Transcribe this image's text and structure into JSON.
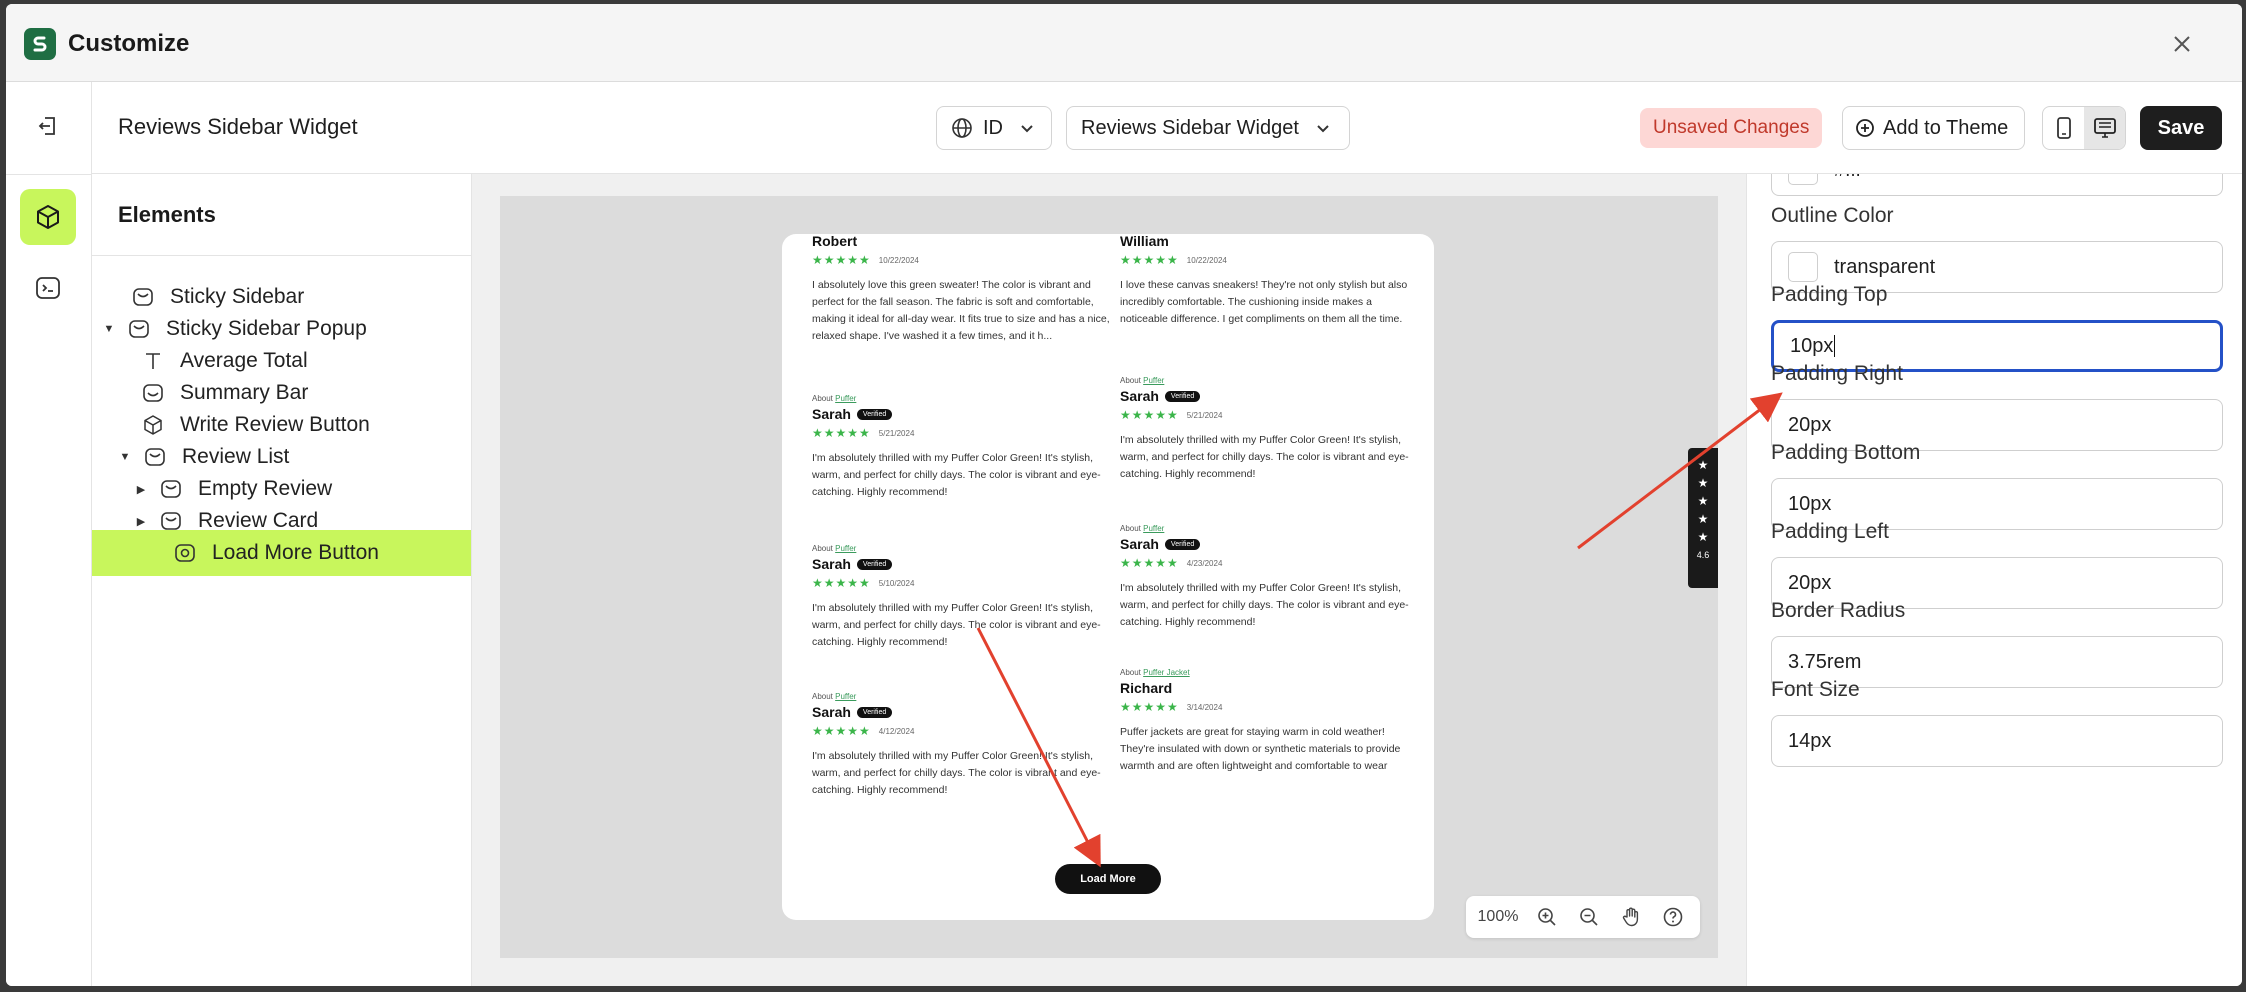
{
  "app": {
    "title": "Customize"
  },
  "toolbar": {
    "page_name": "Reviews Sidebar Widget",
    "language": "ID",
    "template": "Reviews Sidebar Widget",
    "unsaved": "Unsaved Changes",
    "add_to_theme": "Add to Theme",
    "save": "Save"
  },
  "elements_panel": {
    "title": "Elements",
    "items": [
      {
        "label": "Sticky Sidebar",
        "icon": "section-icon",
        "caret": ""
      },
      {
        "label": "Sticky Sidebar Popup",
        "icon": "section-icon",
        "caret": "expanded"
      },
      {
        "label": "Average Total",
        "icon": "text-icon",
        "caret": ""
      },
      {
        "label": "Summary Bar",
        "icon": "section-icon",
        "caret": ""
      },
      {
        "label": "Write Review Button",
        "icon": "box-icon",
        "caret": ""
      },
      {
        "label": "Review List",
        "icon": "section-icon",
        "caret": "expanded"
      },
      {
        "label": "Empty Review",
        "icon": "section-icon",
        "caret": "collapsed"
      },
      {
        "label": "Review Card",
        "icon": "section-icon",
        "caret": "collapsed"
      },
      {
        "label": "Load More Button",
        "icon": "button-icon",
        "caret": "",
        "selected": true
      }
    ]
  },
  "preview": {
    "reviews": [
      {
        "about": "",
        "product": "",
        "name": "Robert",
        "verified": false,
        "stars": "★★★★★",
        "date": "10/22/2024",
        "body": "I absolutely love this green sweater! The color is vibrant and perfect for the fall season. The fabric is soft and comfortable, making it ideal for all-day wear. It fits true to size and has a nice, relaxed shape. I've washed it a few times, and it h..."
      },
      {
        "about": "",
        "product": "",
        "name": "William",
        "verified": false,
        "stars": "★★★★★",
        "date": "10/22/2024",
        "body": "I love these canvas sneakers! They're not only stylish but also incredibly comfortable. The cushioning inside makes a noticeable difference. I get compliments on them all the time."
      },
      {
        "about": "About",
        "product": "Puffer",
        "name": "Sarah",
        "verified": true,
        "stars": "★★★★★",
        "date": "5/21/2024",
        "body": "I'm absolutely thrilled with my Puffer Color Green! It's stylish, warm, and perfect for chilly days. The color is vibrant and eye-catching. Highly recommend!"
      },
      {
        "about": "About",
        "product": "Puffer",
        "name": "Sarah",
        "verified": true,
        "stars": "★★★★★",
        "date": "5/21/2024",
        "body": "I'm absolutely thrilled with my Puffer Color Green! It's stylish, warm, and perfect for chilly days. The color is vibrant and eye-catching. Highly recommend!"
      },
      {
        "about": "About",
        "product": "Puffer",
        "name": "Sarah",
        "verified": true,
        "stars": "★★★★★",
        "date": "5/10/2024",
        "body": "I'm absolutely thrilled with my Puffer Color Green! It's stylish, warm, and perfect for chilly days. The color is vibrant and eye-catching. Highly recommend!"
      },
      {
        "about": "About",
        "product": "Puffer",
        "name": "Sarah",
        "verified": true,
        "stars": "★★★★★",
        "date": "4/23/2024",
        "body": "I'm absolutely thrilled with my Puffer Color Green! It's stylish, warm, and perfect for chilly days. The color is vibrant and eye-catching. Highly recommend!"
      },
      {
        "about": "About",
        "product": "Puffer",
        "name": "Sarah",
        "verified": true,
        "stars": "★★★★★",
        "date": "4/12/2024",
        "body": "I'm absolutely thrilled with my Puffer Color Green! It's stylish, warm, and perfect for chilly days. The color is vibrant and eye-catching. Highly recommend!"
      },
      {
        "about": "About",
        "product": "Puffer Jacket",
        "name": "Richard",
        "verified": false,
        "stars": "★★★★★",
        "date": "3/14/2024",
        "body": "Puffer jackets are great for staying warm in cold weather! They're insulated with down or synthetic materials to provide warmth and are often lightweight and comfortable to wear"
      }
    ],
    "verified_label": "Verified",
    "load_more": "Load More",
    "sticky_stars": "★",
    "sticky_rating": "4.6",
    "zoom": "100%"
  },
  "properties": {
    "top_partial": "#fff",
    "outline_color_label": "Outline Color",
    "outline_color": "transparent",
    "padding_top_label": "Padding Top",
    "padding_top": "10px",
    "padding_right_label": "Padding Right",
    "padding_right": "20px",
    "padding_bottom_label": "Padding Bottom",
    "padding_bottom": "10px",
    "padding_left_label": "Padding Left",
    "padding_left": "20px",
    "border_radius_label": "Border Radius",
    "border_radius": "3.75rem",
    "font_size_label": "Font Size",
    "font_size": "14px"
  },
  "colors": {
    "accent_green": "#c8f65c",
    "save_bg": "#1e1e1e",
    "unsaved_bg": "#fdd7d5",
    "focus_blue": "#2451c7",
    "annotation_red": "#e2412e",
    "star_green": "#3bb54a"
  }
}
